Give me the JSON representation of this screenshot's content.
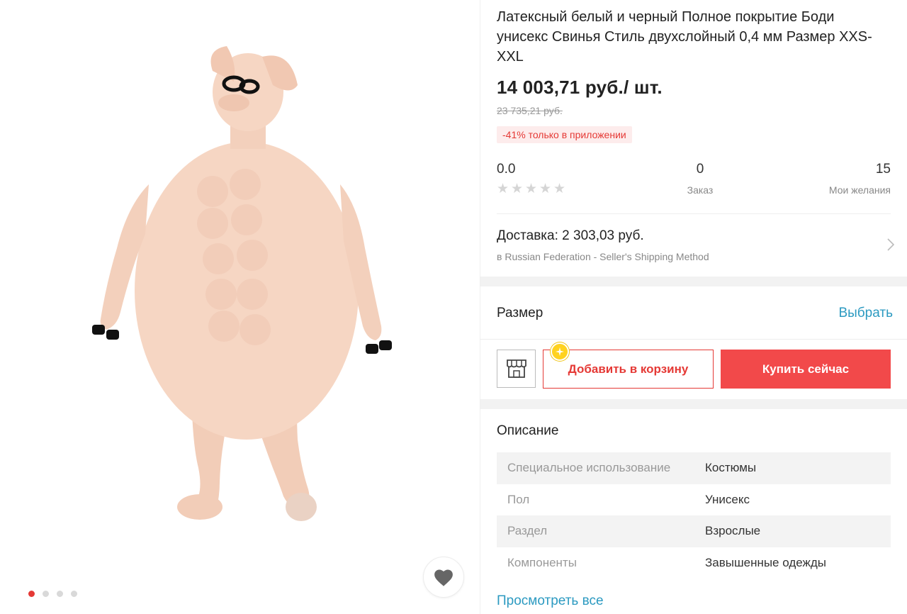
{
  "product": {
    "title": "Латексный белый и черный Полное покрытие Боди унисекс Свинья Стиль двухслойный 0,4 мм Размер XXS-XXL",
    "price": "14 003,71 руб./ шт.",
    "old_price": "23 735,21 руб.",
    "discount": "-41% только в приложении"
  },
  "gallery": {
    "image_icon": "pig-costume-photo",
    "dots_count": 4,
    "active_dot": 0,
    "favorite_icon": "heart-icon"
  },
  "stats": {
    "rating": "0.0",
    "stars_filled": 0,
    "stars_total": 5,
    "orders_value": "0",
    "orders_label": "Заказ",
    "wishlist_value": "15",
    "wishlist_label": "Мои желания"
  },
  "delivery": {
    "title": "Доставка: 2 303,03 руб.",
    "subtitle": "в Russian Federation - Seller's Shipping Method"
  },
  "size": {
    "label": "Размер",
    "action": "Выбрать"
  },
  "actions": {
    "store_icon": "store-icon",
    "add_to_cart": "Добавить в корзину",
    "buy_now": "Купить сейчас"
  },
  "description": {
    "title": "Описание",
    "specs": [
      {
        "key": "Специальное использование",
        "value": "Костюмы"
      },
      {
        "key": "Пол",
        "value": "Унисекс"
      },
      {
        "key": "Раздел",
        "value": "Взрослые"
      },
      {
        "key": "Компоненты",
        "value": "Завышенные одежды"
      }
    ],
    "view_all": "Просмотреть все"
  },
  "colors": {
    "accent_red": "#e53935",
    "buy_button": "#f2494a",
    "link_blue": "#2c9ac1",
    "discount_bg": "#fdecec"
  }
}
